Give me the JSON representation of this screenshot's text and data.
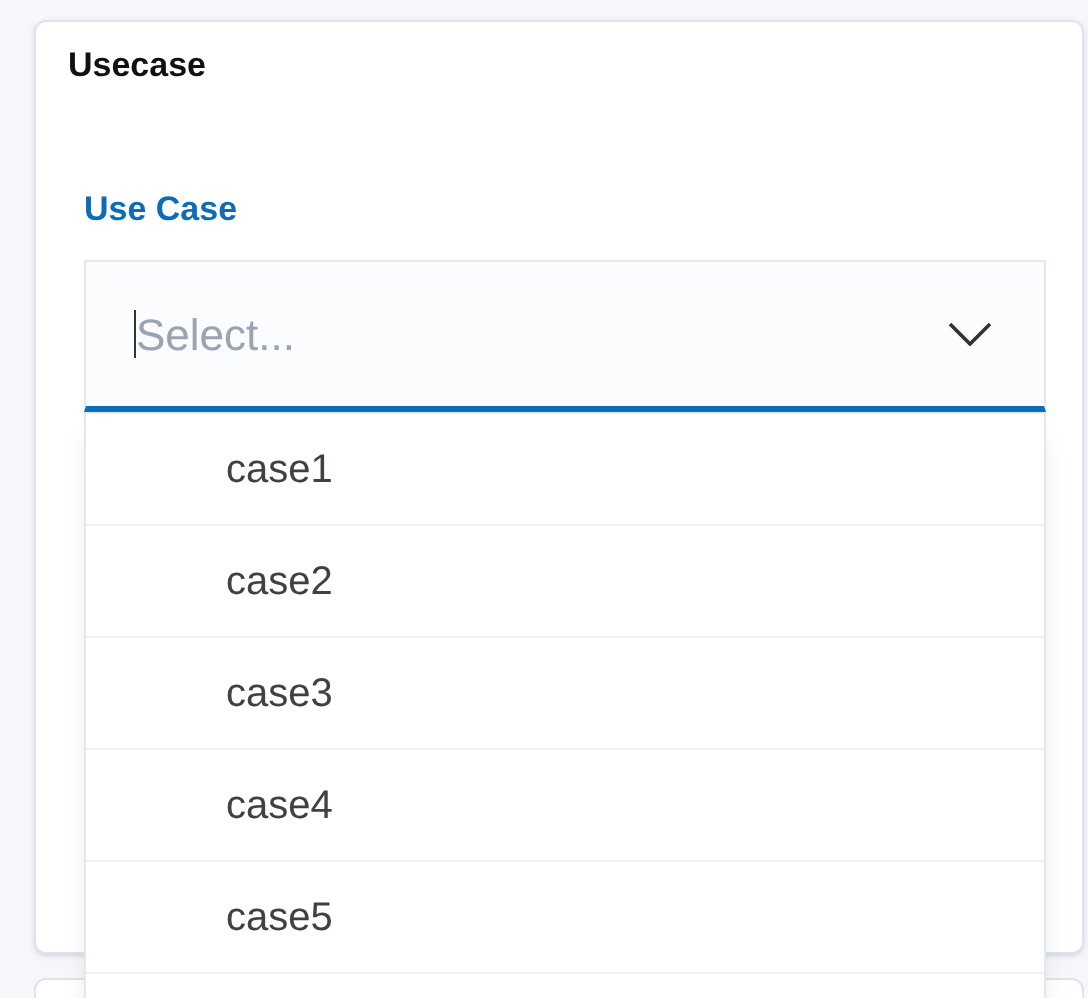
{
  "card": {
    "title": "Usecase"
  },
  "field": {
    "label": "Use Case",
    "placeholder": "Select...",
    "expanded": true
  },
  "options": [
    "case1",
    "case2",
    "case3",
    "case4",
    "case5"
  ]
}
